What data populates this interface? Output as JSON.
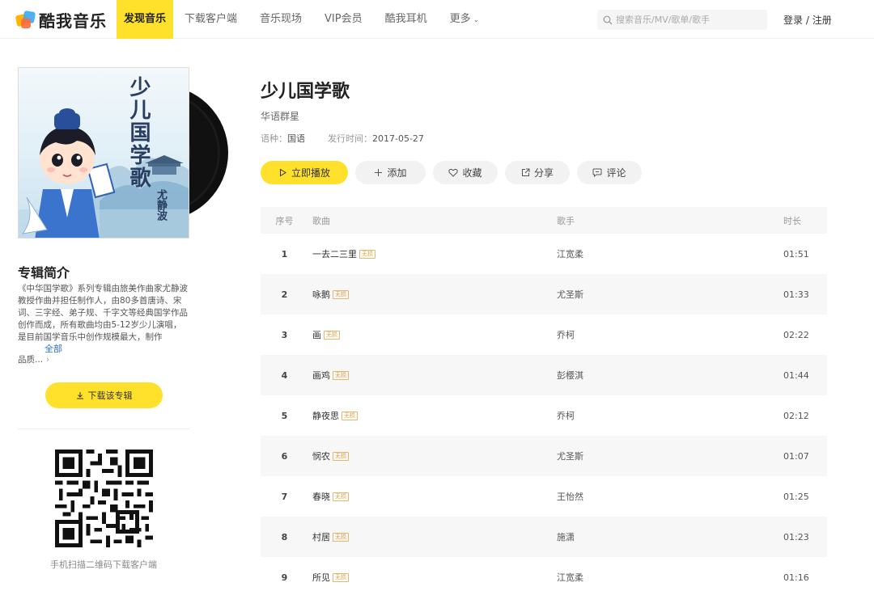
{
  "brand": {
    "name": "酷我音乐"
  },
  "nav": {
    "items": [
      "发现音乐",
      "下载客户端",
      "音乐现场",
      "VIP会员",
      "酷我耳机",
      "更多"
    ],
    "active_index": 0
  },
  "search": {
    "placeholder": "搜索音乐/MV/歌单/歌手"
  },
  "auth": {
    "login": "登录",
    "sep": " / ",
    "register": "注册"
  },
  "cover": {
    "title": "少儿国学歌",
    "author": "尤静波"
  },
  "album": {
    "title": "少儿国学歌",
    "artist": "华语群星",
    "language_label": "语种：",
    "language": "国语",
    "release_label": "发行时间：",
    "release_date": "2017-05-27"
  },
  "actions": {
    "play": "立即播放",
    "add": "添加",
    "fav": "收藏",
    "share": "分享",
    "comment": "评论"
  },
  "intro": {
    "title": "专辑简介",
    "text": "《中华国学歌》系列专辑由旅美作曲家尤静波教授作曲并担任制作人，由80多首唐诗、宋词、三字经、弟子规、千字文等经典国学作品创作而成，所有歌曲均由5-12岁少儿演唱，是目前国学音乐中创作规模最大，制作",
    "more": "全部",
    "tail": "品质..."
  },
  "download_album": "下载该专辑",
  "qr_caption": "手机扫描二维码下载客户端",
  "table": {
    "headers": {
      "no": "序号",
      "song": "歌曲",
      "artist": "歌手",
      "duration": "时长"
    },
    "tag_label": "无损",
    "rows": [
      {
        "no": "1",
        "song": "一去二三里",
        "artist": "江宽柔",
        "duration": "01:51"
      },
      {
        "no": "2",
        "song": "咏鹅",
        "artist": "尤圣斯",
        "duration": "01:33"
      },
      {
        "no": "3",
        "song": "画",
        "artist": "乔柯",
        "duration": "02:22"
      },
      {
        "no": "4",
        "song": "画鸡",
        "artist": "彭樱淇",
        "duration": "01:44"
      },
      {
        "no": "5",
        "song": "静夜思",
        "artist": "乔柯",
        "duration": "02:12"
      },
      {
        "no": "6",
        "song": "悯农",
        "artist": "尤圣斯",
        "duration": "01:07"
      },
      {
        "no": "7",
        "song": "春晓",
        "artist": "王怡然",
        "duration": "01:25"
      },
      {
        "no": "8",
        "song": "村居",
        "artist": "施潇",
        "duration": "01:23"
      },
      {
        "no": "9",
        "song": "所见",
        "artist": "江宽柔",
        "duration": "01:16"
      }
    ]
  },
  "colors": {
    "accent": "#ffe12c",
    "link": "#2a6fd6",
    "tag": "#e0a040"
  }
}
